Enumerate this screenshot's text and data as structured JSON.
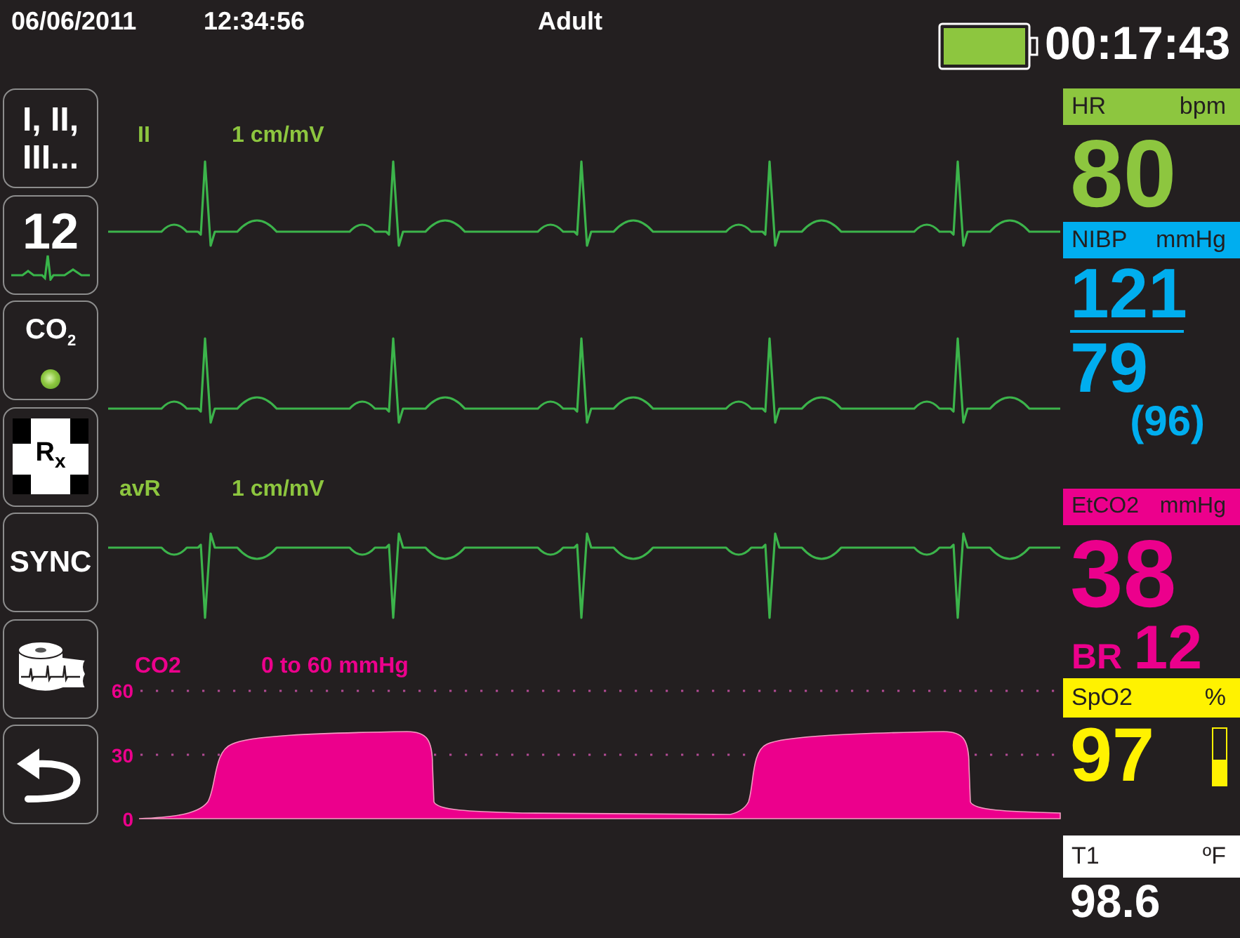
{
  "top_bar": {
    "date": "06/06/2011",
    "time": "12:34:56",
    "patient_mode": "Adult",
    "elapsed_time": "00:17:43"
  },
  "sidebar_buttons": [
    {
      "kind": "leads",
      "label": "I, II, III..."
    },
    {
      "kind": "twelve",
      "label": "12"
    },
    {
      "kind": "co2",
      "label": "CO$_{2}$",
      "on": true
    },
    {
      "kind": "rx",
      "label": "R$_{x}$"
    },
    {
      "kind": "sync",
      "label": "SYNC"
    },
    {
      "kind": "print"
    },
    {
      "kind": "back"
    }
  ],
  "waveforms": [
    {
      "kind": "upright",
      "lead": "II",
      "scale": "1 cm/mV"
    },
    {
      "kind": "upright"
    },
    {
      "kind": "inverted",
      "lead": "avR",
      "scale": "1 cm/mV"
    }
  ],
  "co2_waveform": {
    "label": "CO2",
    "scale": "0 to 60 mmHg",
    "axis_labels": [
      "60",
      "30",
      "0"
    ]
  },
  "vitals": [
    {
      "kind": "large",
      "color": "#8dc63f",
      "name": "HR",
      "unit": "bpm",
      "value": "80"
    },
    {
      "kind": "pressure",
      "color": "#00aeef",
      "name": "NIBP",
      "unit": "mmHg",
      "systolic": "121",
      "diastolic": "79",
      "mean": "(96)"
    },
    {
      "kind": "capno",
      "color": "#ec008c",
      "name": "EtCO2",
      "unit": "mmHg",
      "value": "38",
      "rate_label": "BR",
      "rate": "12"
    },
    {
      "kind": "oximetry",
      "color": "#fff200",
      "name": "SpO2",
      "unit": "%",
      "value": "97",
      "level": 0.45
    },
    {
      "kind": "small",
      "color": "#ffffff",
      "name": "T1",
      "unit": "ºF",
      "value": "98.6"
    }
  ]
}
